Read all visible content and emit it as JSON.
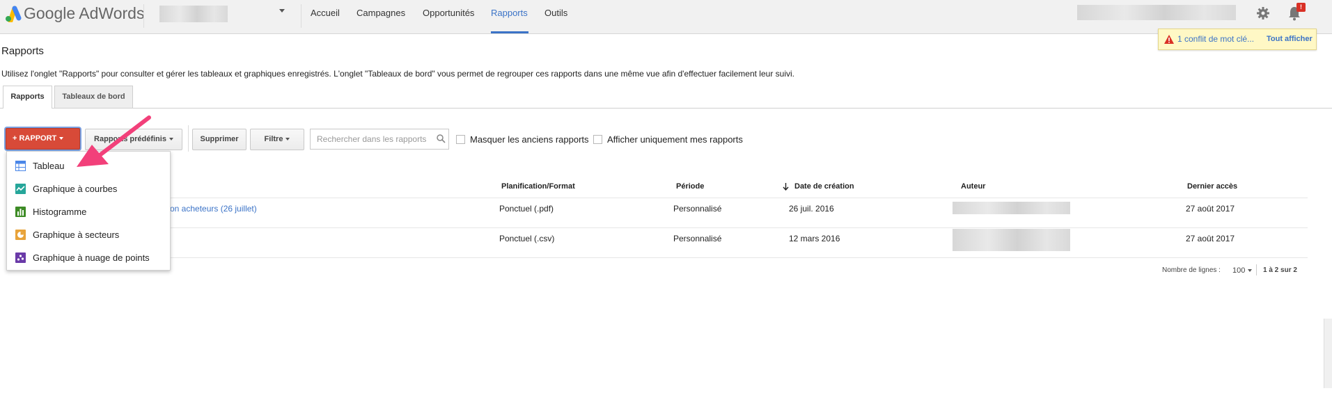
{
  "app": {
    "name": "Google AdWords"
  },
  "nav": {
    "items": [
      {
        "label": "Accueil"
      },
      {
        "label": "Campagnes"
      },
      {
        "label": "Opportunités"
      },
      {
        "label": "Rapports",
        "active": true
      },
      {
        "label": "Outils"
      }
    ]
  },
  "notifications": {
    "badge": "!",
    "text": "1 conflit de mot clé...",
    "link": "Tout afficher"
  },
  "page": {
    "title": "Rapports",
    "description": "Utilisez l'onglet \"Rapports\" pour consulter et gérer les tableaux et graphiques enregistrés. L'onglet \"Tableaux de bord\" vous permet de regrouper ces rapports dans une même vue afin d'effectuer facilement leur suivi."
  },
  "tabs": [
    {
      "label": "Rapports",
      "active": true
    },
    {
      "label": "Tableaux de bord"
    }
  ],
  "toolbar": {
    "rapport_label": "+ RAPPORT",
    "predefined_label": "Rapports prédéfinis",
    "delete_label": "Supprimer",
    "filter_label": "Filtre",
    "search_placeholder": "Rechercher dans les rapports",
    "hide_old_label": "Masquer les anciens rapports",
    "only_mine_label": "Afficher uniquement mes rapports"
  },
  "menu": {
    "items": [
      {
        "label": "Tableau",
        "icon": "table-icon",
        "color": "#4a86e8"
      },
      {
        "label": "Graphique à courbes",
        "icon": "line-chart-icon",
        "color": "#26a69a"
      },
      {
        "label": "Histogramme",
        "icon": "bar-chart-icon",
        "color": "#3d8b25"
      },
      {
        "label": "Graphique à secteurs",
        "icon": "pie-chart-icon",
        "color": "#e8a33a"
      },
      {
        "label": "Graphique à nuage de points",
        "icon": "scatter-chart-icon",
        "color": "#6a3aa8"
      }
    ]
  },
  "table": {
    "headers": {
      "schedule": "Planification/Format",
      "period": "Période",
      "created": "Date de création",
      "author": "Auteur",
      "last_access": "Dernier accès"
    },
    "rows": [
      {
        "name_fragment": "on acheteurs (26 juillet)",
        "schedule": "Ponctuel (.pdf)",
        "period": "Personnalisé",
        "created": "26 juil. 2016",
        "last_access": "27 août 2017"
      },
      {
        "name_fragment": "",
        "schedule": "Ponctuel (.csv)",
        "period": "Personnalisé",
        "created": "12 mars 2016",
        "last_access": "27 août 2017"
      }
    ]
  },
  "footer": {
    "rows_label": "Nombre de lignes :",
    "rows_value": "100",
    "range": "1 à 2 sur 2"
  },
  "colors": {
    "accent": "#3b73c7",
    "rapport_button": "#d84a38",
    "annotation_arrow": "#f2407a",
    "notification_bg": "#fff8c5"
  }
}
